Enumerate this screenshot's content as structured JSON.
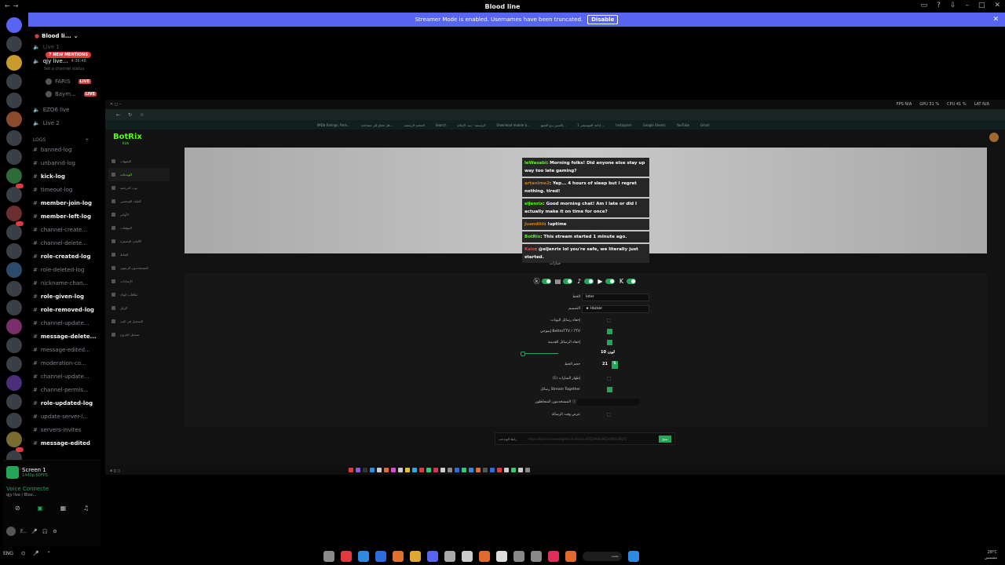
{
  "window": {
    "title": "Blood line"
  },
  "streamer_banner": {
    "text": "Streamer Mode is enabled. Usernames have been truncated.",
    "button": "Disable"
  },
  "server": {
    "name": "Blood li...",
    "mentions": "7 NEW MENTIONS"
  },
  "voice_top": [
    {
      "label": "Live 1",
      "extra": ""
    },
    {
      "label": "qjy live...",
      "extra": "4:36:48"
    },
    {
      "label": "Set a channel status",
      "extra": ""
    },
    {
      "label": "FARIS",
      "extra": "LIVE"
    },
    {
      "label": "Baym...",
      "extra": "LIVE"
    },
    {
      "label": "EZO6 live",
      "extra": ""
    },
    {
      "label": "Live 2",
      "extra": ""
    }
  ],
  "category": "LOGS",
  "channels": [
    {
      "name": "banned-log",
      "unread": false
    },
    {
      "name": "unbannd-log",
      "unread": false
    },
    {
      "name": "kick-log",
      "unread": true
    },
    {
      "name": "timeout-log",
      "unread": false
    },
    {
      "name": "member-join-log",
      "unread": true
    },
    {
      "name": "member-left-log",
      "unread": true
    },
    {
      "name": "channel-create...",
      "unread": false
    },
    {
      "name": "channel-delete...",
      "unread": false
    },
    {
      "name": "role-created-log",
      "unread": true
    },
    {
      "name": "role-deleted-log",
      "unread": false
    },
    {
      "name": "nickname-chan...",
      "unread": false
    },
    {
      "name": "role-given-log",
      "unread": true
    },
    {
      "name": "role-removed-log",
      "unread": true
    },
    {
      "name": "channel-update...",
      "unread": false
    },
    {
      "name": "message-delete...",
      "unread": true
    },
    {
      "name": "message-edited...",
      "unread": false
    },
    {
      "name": "moderation-co...",
      "unread": false
    },
    {
      "name": "channel-update...",
      "unread": false
    },
    {
      "name": "channel-permis...",
      "unread": false
    },
    {
      "name": "role-updated-log",
      "unread": true
    },
    {
      "name": "update-server-l...",
      "unread": false
    },
    {
      "name": "servers-invites",
      "unread": false
    },
    {
      "name": "message-edited",
      "unread": true
    }
  ],
  "user_panel": {
    "screen_title": "Screen 1",
    "screen_sub": "1440p 60FPS",
    "voice_status": "Voice Connecte",
    "voice_sub": "qjy live / Bloo...",
    "user_name": "F..."
  },
  "browser": {
    "perf": [
      "FPS N/A",
      "GPU 31 %",
      "CPU 41 %",
      "LAT N/A"
    ],
    "bookmarks": [
      "IMDb Ratings, Rem...",
      "هل تحتاج إلى مساعدة...",
      "المنصة الرسمية",
      "Search",
      "الرئيسية - بيت الإعلام",
      "Download mobile b...",
      "إكسبي برو الجمع...",
      "إذاعة الموسيقى 1 ...",
      "Instagram",
      "Google Sheets",
      "YouTube",
      "Gmail"
    ]
  },
  "botrix": {
    "brand": "BotRix",
    "brand_sub": "Kick",
    "nav": [
      "التنبيهات",
      "الويدجات",
      "بوت الدردشة",
      "الملف الشخصي",
      "الأوامر",
      "المؤقتات",
      "الألعاب المصغرة",
      "النقاط",
      "المستخدمون الرعيون",
      "الإعدادات",
      "مكافآت الولاء",
      "الزوار",
      "التسجيل في البث",
      "تسجيل الخروج"
    ],
    "chat": [
      {
        "user": "leWasabi",
        "text": ": Morning folks! Did anyone else stay up way too late gaming?",
        "color": "u"
      },
      {
        "user": "artanime2",
        "text": ": Yep... 4 hours of sleep but I regret nothing. tired!",
        "color": "u2"
      },
      {
        "user": "elJenrix",
        "text": ": Good morning chat! Am I late or did I actually make it on time for once?",
        "color": "u"
      },
      {
        "user": "Juandiiii",
        "text": ": !uptime",
        "color": "u2"
      },
      {
        "user": "BotRix",
        "text": ": This stream started 1 minute ago.",
        "color": "u"
      },
      {
        "user": "Kaio",
        "text": ": @elJenrix lol you're safe, we literally just started.",
        "color": "u4"
      }
    ],
    "settings_title": "خيارات",
    "settings": {
      "font_label": "الخط",
      "font_value": "Inter",
      "theme_label": "التصميم",
      "theme_value": "★ Hacker",
      "hide_commands": "إخفاء رسائل البوتات",
      "bttv": "إيموجي BetterTTV / 7TV",
      "hide_old": "إخفاء الرسائل القديمة",
      "size_label": "لون 10",
      "fontsize_label": "حجم الخط",
      "fontsize_value": "21",
      "show_badges": "إظهار الشارات (1)",
      "stream_together": "رسائل Stream Together",
      "ignored_users": "المستخدمون المتجاهلون",
      "show_time": "عرض وقت الرسالة"
    },
    "url_label": "رابط الويدجت",
    "url_value": "https://botrix.live/widgets/chat?bid=NTQ1MjAxMDAzNDk3NjY2",
    "copy_button": "نسخ"
  },
  "taskbar": {
    "search": "بحث",
    "weather": "28°C",
    "clock": "مشمس"
  }
}
